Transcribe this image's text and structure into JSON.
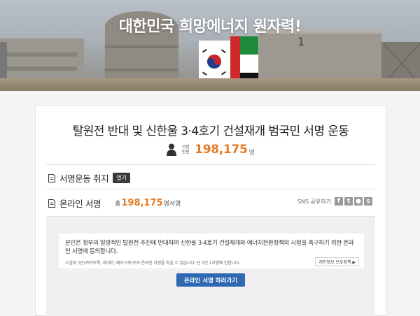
{
  "hero": {
    "title": "대한민국 희망에너지 원자력!"
  },
  "campaign": {
    "title": "탈원전 반대 및 신한울 3·4호기 건설재개 범국민 서명 운동",
    "signature_label": "서명\n인원",
    "signature_count": "198,175",
    "signature_unit": "명"
  },
  "purpose": {
    "label": "서명운동 취지",
    "open_label": "열기"
  },
  "online": {
    "label": "온라인 서명",
    "total_prefix": "총",
    "total_count": "198,175",
    "total_suffix": "명서명"
  },
  "sns": {
    "label": "SNS 공유하기",
    "buttons": [
      {
        "icon": "facebook-icon",
        "glyph": "f"
      },
      {
        "icon": "twitter-icon",
        "glyph": "t"
      },
      {
        "icon": "kakaotalk-icon",
        "glyph": "●"
      },
      {
        "icon": "kakaostory-icon",
        "glyph": "s"
      }
    ]
  },
  "petition": {
    "statement": "본인은 정부의 일방적인 탈원전 추진에 반대하며 신한울 3·4호기 건설재개와 에너지전환정책의 시정을 촉구하기 위한 온라인 서명에 동의합니다.",
    "note": "소셜로그인(카카오톡, 네이버, 페이스북)으로 온라인 서명을 하실 수 있습니다. 단 1인 1서명에 한합니다.",
    "privacy_label": "개인정보 보호정책 ▶",
    "sign_button": "온라인 서명 하러가기"
  },
  "colors": {
    "accent": "#e37b25",
    "primary_button": "#2e67b2"
  }
}
